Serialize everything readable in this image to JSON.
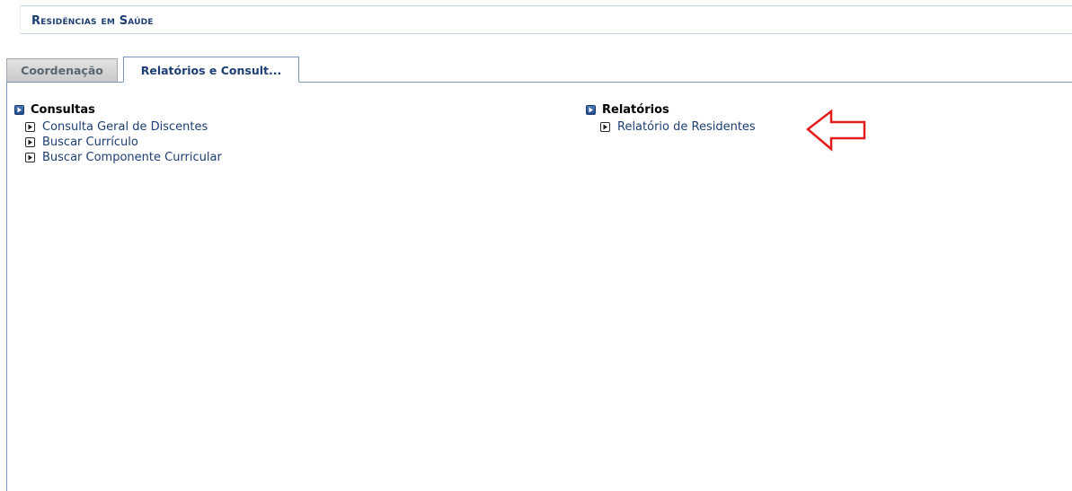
{
  "header": {
    "title": "Residências em Saúde"
  },
  "tabs": [
    {
      "label": "Coordenação",
      "active": false
    },
    {
      "label": "Relatórios e Consult...",
      "active": true
    }
  ],
  "sections": [
    {
      "title": "Consultas",
      "items": [
        {
          "label": "Consulta Geral de Discentes"
        },
        {
          "label": "Buscar Currículo"
        },
        {
          "label": "Buscar Componente Curricular"
        }
      ]
    },
    {
      "title": "Relatórios",
      "items": [
        {
          "label": "Relatório de Residentes"
        }
      ]
    }
  ],
  "colors": {
    "link": "#1c3e73",
    "annotation_arrow": "#e31b1b",
    "section_icon": "#2a5597"
  },
  "icons": {
    "section": "blue-square-arrow-icon",
    "item": "square-arrow-icon",
    "annotation": "left-arrow-outline-icon"
  }
}
